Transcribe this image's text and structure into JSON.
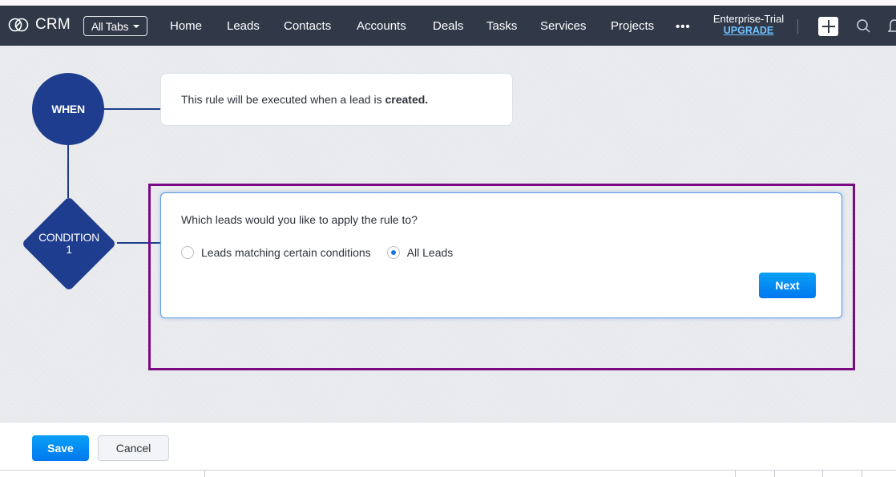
{
  "navbar": {
    "logo_text": "CRM",
    "all_tabs_label": "All Tabs",
    "items": [
      {
        "label": "Home"
      },
      {
        "label": "Leads"
      },
      {
        "label": "Contacts"
      },
      {
        "label": "Accounts"
      },
      {
        "label": "Deals"
      },
      {
        "label": "Tasks"
      },
      {
        "label": "Services"
      },
      {
        "label": "Projects"
      }
    ],
    "more_label": "•••",
    "plan_label": "Enterprise-Trial",
    "upgrade_label": "UPGRADE",
    "icons": [
      "crm-logo-icon",
      "caret-down-icon",
      "more-icon",
      "plus-icon",
      "search-icon",
      "bell-icon"
    ]
  },
  "flow": {
    "when_node_label": "WHEN",
    "when_card_text": "This rule will be executed when a lead is ",
    "when_card_bold": "created.",
    "condition_node_label": "CONDITION",
    "condition_node_number": "1",
    "condition_card": {
      "question": "Which leads would you like to apply the rule to?",
      "options": [
        {
          "label": "Leads matching certain conditions",
          "selected": false
        },
        {
          "label": "All Leads",
          "selected": true
        }
      ],
      "next_label": "Next"
    }
  },
  "footer": {
    "save_label": "Save",
    "cancel_label": "Cancel"
  },
  "colors": {
    "navbar_bg": "#313949",
    "node_blue": "#1f3d8e",
    "primary_button": "#0a8cf2",
    "highlight_border": "#7b0a85",
    "upgrade_link": "#6fc3ff"
  }
}
